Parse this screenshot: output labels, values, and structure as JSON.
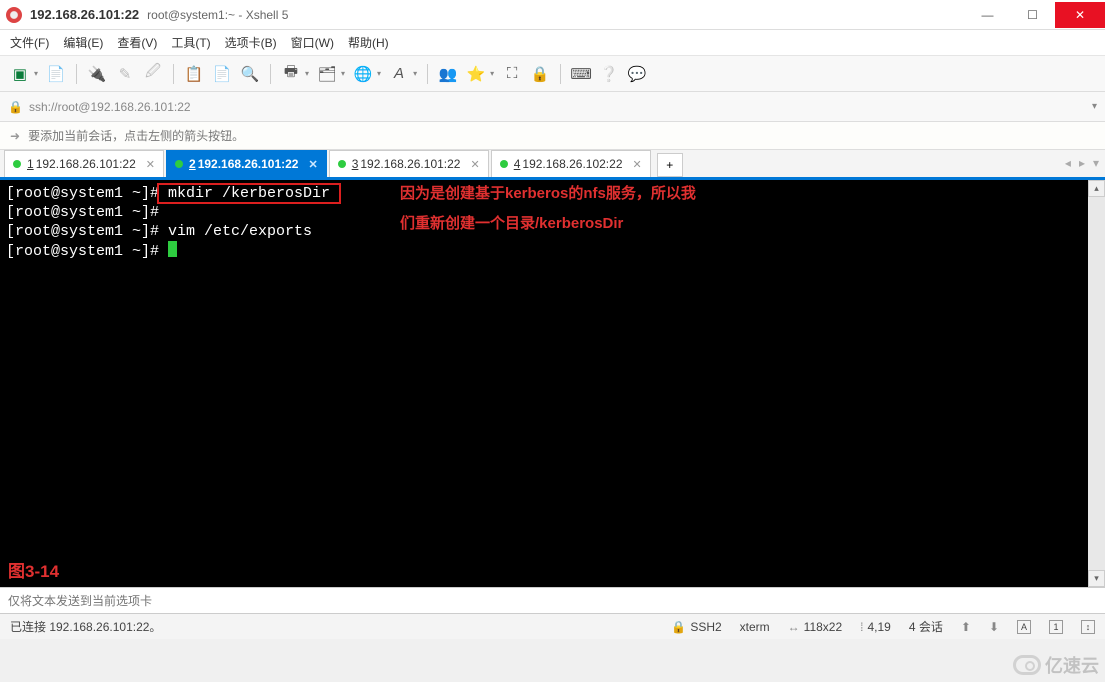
{
  "titlebar": {
    "main": "192.168.26.101:22",
    "sub": "root@system1:~ - Xshell 5"
  },
  "menu": {
    "file": "文件(F)",
    "edit": "编辑(E)",
    "view": "查看(V)",
    "tools": "工具(T)",
    "tabs": "选项卡(B)",
    "window": "窗口(W)",
    "help": "帮助(H)"
  },
  "addressbar": {
    "url": "ssh://root@192.168.26.101:22"
  },
  "infobar": {
    "text": "要添加当前会话，点击左侧的箭头按钮。"
  },
  "tabs": [
    {
      "num": "1",
      "label": "192.168.26.101:22",
      "active": false
    },
    {
      "num": "2",
      "label": "192.168.26.101:22",
      "active": true
    },
    {
      "num": "3",
      "label": "192.168.26.101:22",
      "active": false
    },
    {
      "num": "4",
      "label": "192.168.26.102:22",
      "active": false
    }
  ],
  "terminal": {
    "prompt1": "[root@system1 ~]#",
    "cmd1": " mkdir /kerberosDir ",
    "prompt2": "[root@system1 ~]#",
    "prompt3": "[root@system1 ~]# vim /etc/exports",
    "prompt4": "[root@system1 ~]# ",
    "annot1": "因为是创建基于kerberos的nfs服务，所以我",
    "annot2": "们重新创建一个目录/kerberosDir",
    "figure": "图3-14"
  },
  "sendbar": {
    "placeholder": "仅将文本发送到当前选项卡"
  },
  "statusbar": {
    "left": "已连接 192.168.26.101:22。",
    "ssh": "SSH2",
    "term": "xterm",
    "size": "118x22",
    "pos": "4,19",
    "sessions": "4 会话"
  },
  "watermark": "亿速云"
}
